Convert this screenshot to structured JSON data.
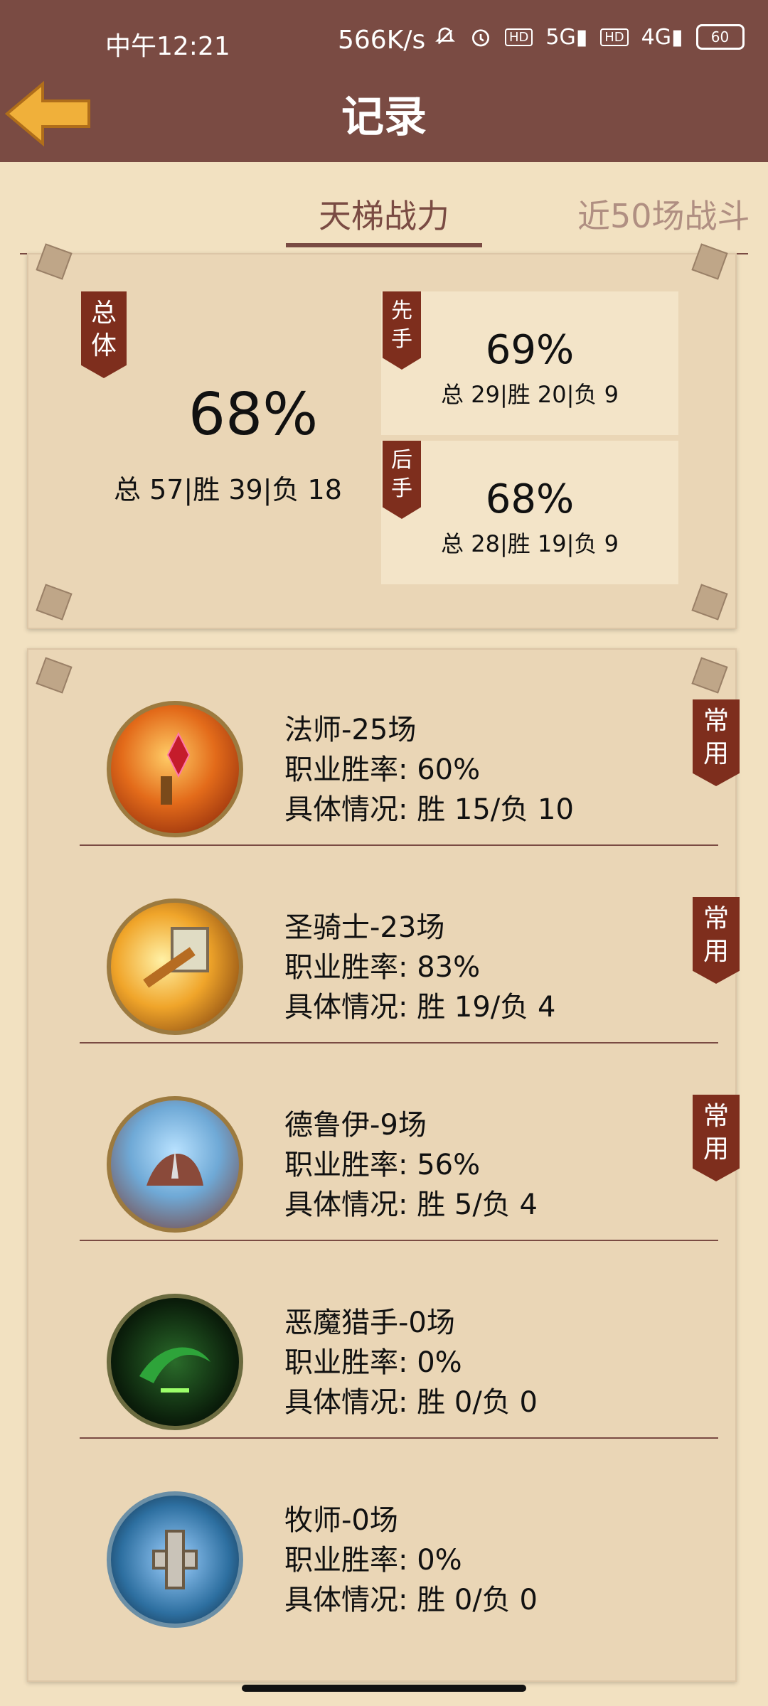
{
  "status": {
    "time": "中午12:21",
    "net": "566K/s",
    "battery": "60",
    "signal_5g": "5G",
    "signal_4g": "4G",
    "hd": "HD"
  },
  "header": {
    "title": "记录"
  },
  "tabs": {
    "ladder": "天梯战力",
    "recent": "近50场战斗"
  },
  "summary": {
    "overall": {
      "label": "总体",
      "pct": "68%",
      "detail": "总 57|胜 39|负 18"
    },
    "first": {
      "label": "先手",
      "pct": "69%",
      "detail": "总 29|胜 20|负 9"
    },
    "second": {
      "label": "后手",
      "pct": "68%",
      "detail": "总 28|胜 19|负 9"
    }
  },
  "heroes": [
    {
      "title": "法师-25场",
      "rate": "职业胜率: 60%",
      "detail": "具体情况: 胜 15/负 10",
      "badge": "常用"
    },
    {
      "title": "圣骑士-23场",
      "rate": "职业胜率: 83%",
      "detail": "具体情况: 胜 19/负 4",
      "badge": "常用"
    },
    {
      "title": "德鲁伊-9场",
      "rate": "职业胜率: 56%",
      "detail": "具体情况: 胜 5/负 4",
      "badge": "常用"
    },
    {
      "title": "恶魔猎手-0场",
      "rate": "职业胜率: 0%",
      "detail": "具体情况: 胜 0/负 0"
    },
    {
      "title": "牧师-0场",
      "rate": "职业胜率: 0%",
      "detail": "具体情况: 胜 0/负 0"
    }
  ],
  "icons": {
    "back": "back-arrow-icon",
    "mute": "mute-bell-icon",
    "alarm": "alarm-icon"
  }
}
